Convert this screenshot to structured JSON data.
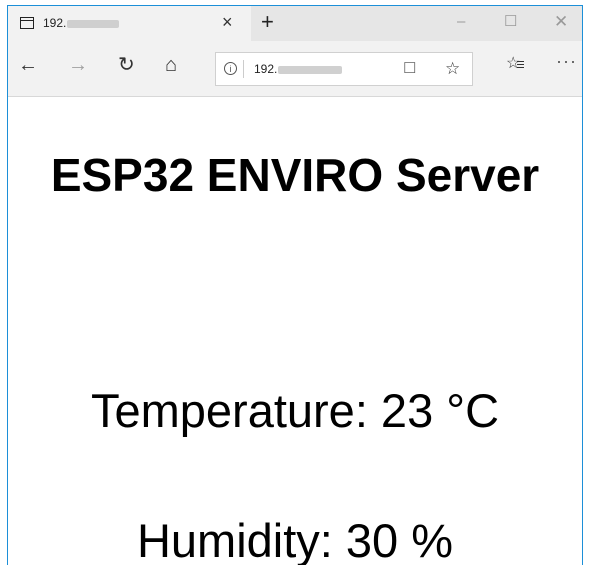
{
  "browser": {
    "tab": {
      "title": "192.",
      "icon": "tab-page-icon"
    },
    "tab_close": "×",
    "new_tab": "+",
    "window": {
      "minimize": "–",
      "maximize": "☐",
      "close": "✕"
    },
    "nav": {
      "back": "←",
      "forward": "→",
      "refresh": "↻",
      "home": "⌂"
    },
    "address": {
      "text": "192.",
      "info_icon": "i"
    },
    "toolbar": {
      "reading_view": "☐",
      "favorite": "☆",
      "favorites_hub": "☆",
      "more": "···"
    }
  },
  "page": {
    "title": "ESP32 ENVIRO Server",
    "temperature": "Temperature: 23 °C",
    "humidity": "Humidity: 30 %"
  }
}
